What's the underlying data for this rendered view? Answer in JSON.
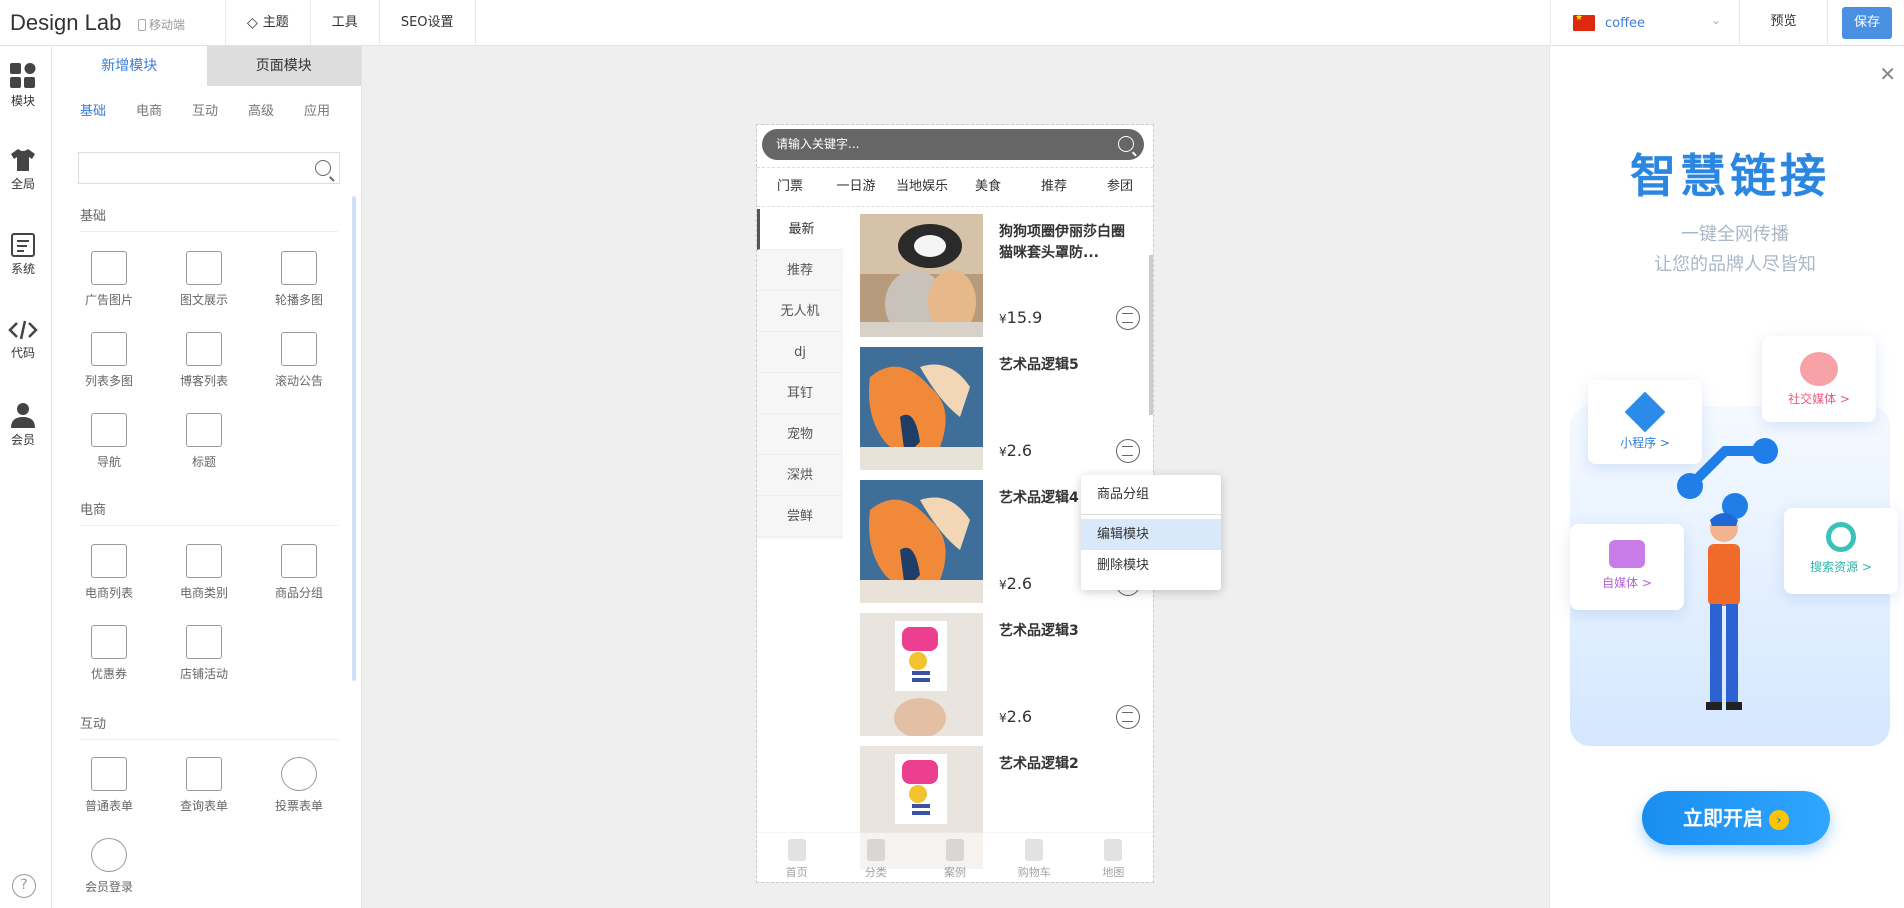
{
  "header": {
    "brand": "Design Lab",
    "mobile_label": "移动端",
    "nav": [
      "主题",
      "工具",
      "SEO设置"
    ],
    "language": "coffee",
    "preview": "预览",
    "save": "保存"
  },
  "iconbar": [
    {
      "label": "模块",
      "icon": "modules-icon"
    },
    {
      "label": "全局",
      "icon": "tshirt-icon"
    },
    {
      "label": "系统",
      "icon": "system-icon"
    },
    {
      "label": "代码",
      "icon": "code-icon"
    },
    {
      "label": "会员",
      "icon": "user-icon"
    }
  ],
  "help": "?",
  "panel": {
    "tabs": [
      "新增模块",
      "页面模块"
    ],
    "categories": [
      "基础",
      "电商",
      "互动",
      "高级",
      "应用"
    ],
    "sections": [
      "基础",
      "电商",
      "互动"
    ],
    "modules": {
      "basic": [
        "广告图片",
        "图文展示",
        "轮播多图",
        "列表多图",
        "博客列表",
        "滚动公告",
        "导航",
        "标题"
      ],
      "ecommerce": [
        "电商列表",
        "电商类别",
        "商品分组",
        "优惠券",
        "店铺活动"
      ],
      "interactive": [
        "普通表单",
        "查询表单",
        "投票表单",
        "会员登录"
      ]
    }
  },
  "phone": {
    "search_placeholder": "请输入关键字...",
    "topnav": [
      "门票",
      "一日游",
      "当地娱乐",
      "美食",
      "推荐",
      "参团"
    ],
    "categories": [
      "最新",
      "推荐",
      "无人机",
      "dj",
      "耳钉",
      "宠物",
      "深烘",
      "尝鲜"
    ],
    "products": [
      {
        "title": "狗狗项圈伊丽莎白圈猫咪套头罩防...",
        "price": "15.9"
      },
      {
        "title": "艺术品逻辑5",
        "price": "2.6"
      },
      {
        "title": "艺术品逻辑4",
        "price": "2.6"
      },
      {
        "title": "艺术品逻辑3",
        "price": "2.6"
      },
      {
        "title": "艺术品逻辑2",
        "price": ""
      }
    ],
    "currency": "¥",
    "bottom_nav": [
      "首页",
      "分类",
      "案例",
      "购物车",
      "地图"
    ]
  },
  "context_menu": [
    "商品分组",
    "编辑模块",
    "删除模块"
  ],
  "promo": {
    "title": "智慧链接",
    "subtitle1": "一键全网传播",
    "subtitle2": "让您的品牌人尽皆知",
    "cards": [
      "社交媒体 >",
      "小程序 >",
      "自媒体 >",
      "搜索资源 >"
    ],
    "button": "立即开启"
  }
}
